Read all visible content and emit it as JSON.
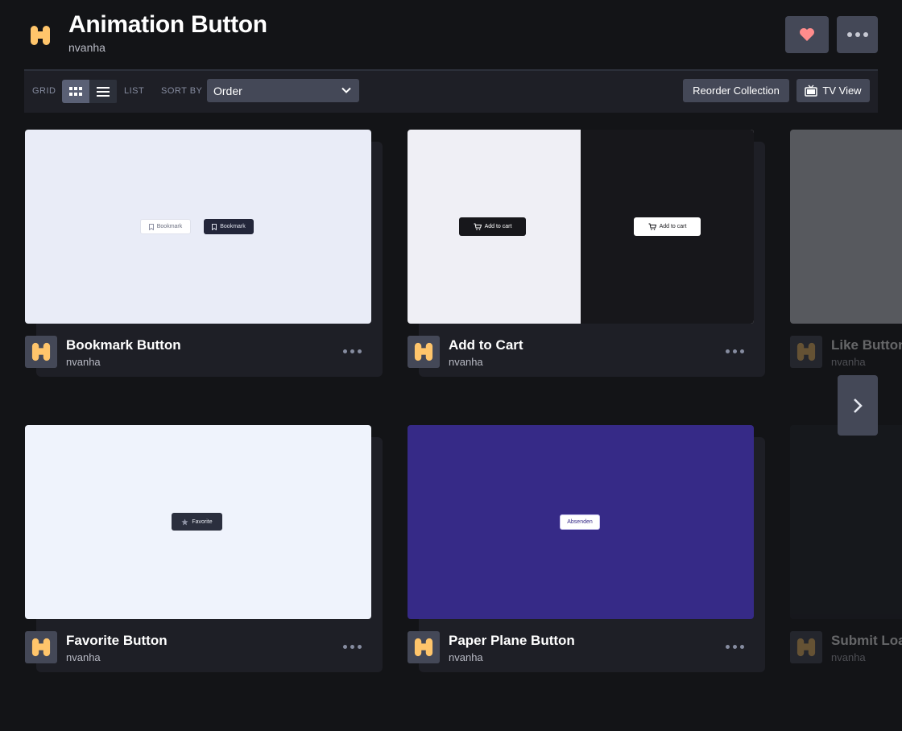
{
  "header": {
    "title": "Animation Button",
    "author": "nvanha",
    "like_icon": "heart-icon",
    "more_icon": "more-dots-icon",
    "accent_colors": {
      "heart": "#ff8c8c",
      "logo": "#ffc56b"
    }
  },
  "toolbar": {
    "grid_label": "GRID",
    "list_label": "LIST",
    "sort_label": "SORT BY",
    "sort_value": "Order",
    "reorder_label": "Reorder Collection",
    "tv_label": "TV View"
  },
  "cards": [
    {
      "title": "Bookmark Button",
      "author": "nvanha",
      "preview": {
        "bg": "#e9ecf7",
        "buttons": [
          "Bookmark",
          "Bookmark"
        ]
      }
    },
    {
      "title": "Add to Cart",
      "author": "nvanha",
      "preview": {
        "left_bg": "#efeff5",
        "right_bg": "#17171b",
        "buttons": [
          "Add to cart",
          "Add to cart"
        ]
      }
    },
    {
      "title": "Like Button",
      "author": "nvanha"
    },
    {
      "title": "Favorite Button",
      "author": "nvanha",
      "preview": {
        "bg": "#eff3fc",
        "buttons": [
          "Favorite"
        ]
      }
    },
    {
      "title": "Paper Plane Button",
      "author": "nvanha",
      "preview": {
        "bg": "#362a87",
        "buttons": [
          "Absenden"
        ]
      }
    },
    {
      "title": "Submit Loader",
      "author": "nvanha"
    }
  ]
}
